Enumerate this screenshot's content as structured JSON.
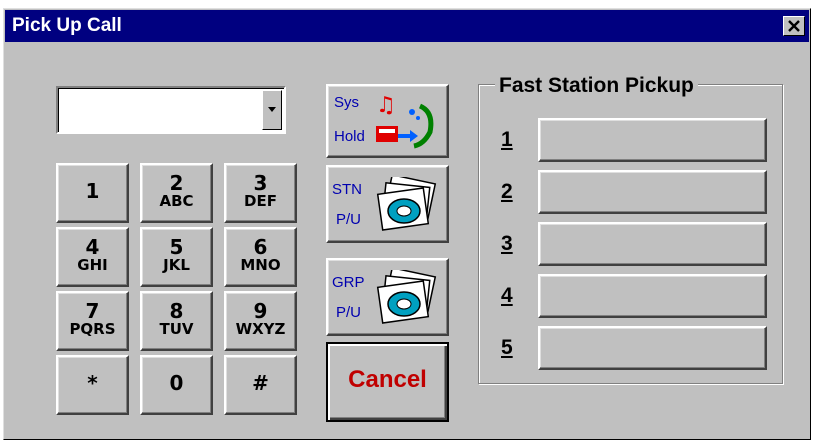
{
  "window": {
    "title": "Pick Up Call"
  },
  "dialer": {
    "value": "",
    "placeholder": ""
  },
  "keypad": [
    {
      "digit": "1",
      "letters": ""
    },
    {
      "digit": "2",
      "letters": "ABC"
    },
    {
      "digit": "3",
      "letters": "DEF"
    },
    {
      "digit": "4",
      "letters": "GHI"
    },
    {
      "digit": "5",
      "letters": "JKL"
    },
    {
      "digit": "6",
      "letters": "MNO"
    },
    {
      "digit": "7",
      "letters": "PQRS"
    },
    {
      "digit": "8",
      "letters": "TUV"
    },
    {
      "digit": "9",
      "letters": "WXYZ"
    },
    {
      "digit": "*",
      "letters": ""
    },
    {
      "digit": "0",
      "letters": ""
    },
    {
      "digit": "#",
      "letters": ""
    }
  ],
  "functions": {
    "sys_hold": {
      "line1": "Sys",
      "line2": "Hold",
      "icon": "music-phone-icon"
    },
    "stn_pickup": {
      "line1": "STN",
      "line2": "P/U",
      "icon": "phone-stack-icon"
    },
    "grp_pickup": {
      "line1": "GRP",
      "line2": "P/U",
      "icon": "phone-stack-icon"
    },
    "cancel": {
      "label": "Cancel",
      "color": "#c00000"
    }
  },
  "fast_station": {
    "title": "Fast Station Pickup",
    "slots": [
      "1",
      "2",
      "3",
      "4",
      "5"
    ]
  },
  "colors": {
    "titlebar": "#000080",
    "face": "#c0c0c0",
    "accent_text": "#0000b0"
  }
}
